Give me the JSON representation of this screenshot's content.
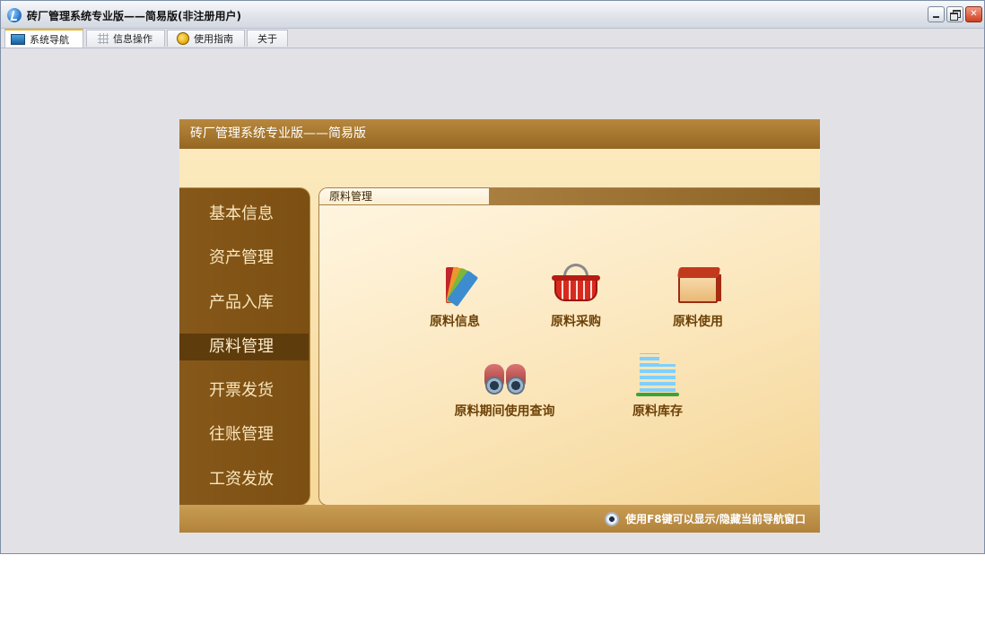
{
  "window": {
    "title": "砖厂管理系统专业版——简易版(非注册用户)",
    "controls": [
      "minimize",
      "restore",
      "close"
    ]
  },
  "tabs": [
    {
      "label": "系统导航",
      "icon": "monitor-icon",
      "active": true
    },
    {
      "label": "信息操作",
      "icon": "grid-icon",
      "active": false
    },
    {
      "label": "使用指南",
      "icon": "lightbulb-icon",
      "active": false
    },
    {
      "label": "关于",
      "icon": "",
      "active": false
    }
  ],
  "nav": {
    "header_title": "砖厂管理系统专业版——简易版",
    "menu": [
      {
        "label": "基本信息"
      },
      {
        "label": "资产管理"
      },
      {
        "label": "产品入库"
      },
      {
        "label": "原料管理"
      },
      {
        "label": "开票发货"
      },
      {
        "label": "往账管理"
      },
      {
        "label": "工资发放"
      }
    ],
    "active_menu": "原料管理",
    "section_title": "原料管理",
    "features": [
      {
        "label": "原料信息",
        "icon": "color-swatch-icon"
      },
      {
        "label": "原料采购",
        "icon": "shopping-basket-icon"
      },
      {
        "label": "原料使用",
        "icon": "box-icon"
      },
      {
        "label": "原料期间使用查询",
        "icon": "binoculars-icon"
      },
      {
        "label": "原料库存",
        "icon": "building-icon"
      }
    ],
    "footer_hint": "使用F8键可以显示/隐藏当前导航窗口"
  },
  "colors": {
    "header_brown": "#a47634",
    "menu_brown": "#7f5215",
    "menu_active": "#5f3c0c",
    "feature_text": "#6d4208",
    "tab_active_accent": "#f0b11c"
  }
}
